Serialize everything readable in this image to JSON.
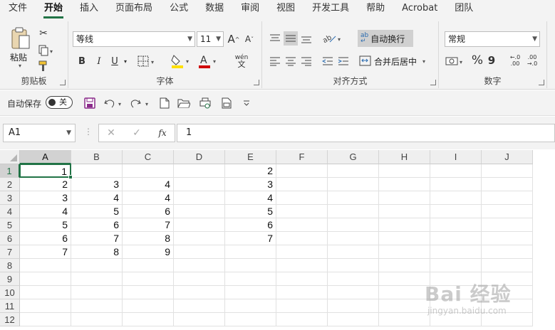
{
  "menu": {
    "tabs": [
      "文件",
      "开始",
      "插入",
      "页面布局",
      "公式",
      "数据",
      "审阅",
      "视图",
      "开发工具",
      "帮助",
      "Acrobat",
      "团队"
    ]
  },
  "ribbon": {
    "clipboard": {
      "label": "剪贴板",
      "paste_label": "粘贴"
    },
    "font": {
      "label": "字体",
      "font_name": "等线",
      "font_size": "11",
      "bold": "B",
      "italic": "I",
      "underline": "U",
      "grow": "A",
      "shrink": "A",
      "color_letter": "A",
      "phonetic": "wén"
    },
    "alignment": {
      "label": "对齐方式",
      "wrap_text": "自动换行",
      "merge_center": "合并后居中"
    },
    "number": {
      "label": "数字",
      "format": "常规",
      "percent": "%",
      "comma": "9"
    }
  },
  "qat": {
    "autosave_label": "自动保存",
    "autosave_state": "关"
  },
  "formula_bar": {
    "name_box": "A1",
    "formula": "1",
    "fx": "fx"
  },
  "sheet": {
    "columns": [
      "A",
      "B",
      "C",
      "D",
      "E",
      "F",
      "G",
      "H",
      "I",
      "J"
    ],
    "rows": [
      "1",
      "2",
      "3",
      "4",
      "5",
      "6",
      "7",
      "8",
      "9",
      "10",
      "11",
      "12"
    ],
    "cells": [
      [
        "1",
        "",
        "",
        "",
        "2",
        "",
        "",
        "",
        "",
        ""
      ],
      [
        "2",
        "3",
        "4",
        "",
        "3",
        "",
        "",
        "",
        "",
        ""
      ],
      [
        "3",
        "4",
        "4",
        "",
        "4",
        "",
        "",
        "",
        "",
        ""
      ],
      [
        "4",
        "5",
        "6",
        "",
        "5",
        "",
        "",
        "",
        "",
        ""
      ],
      [
        "5",
        "6",
        "7",
        "",
        "6",
        "",
        "",
        "",
        "",
        ""
      ],
      [
        "6",
        "7",
        "8",
        "",
        "7",
        "",
        "",
        "",
        "",
        ""
      ],
      [
        "7",
        "8",
        "9",
        "",
        "",
        "",
        "",
        "",
        "",
        ""
      ],
      [
        "",
        "",
        "",
        "",
        "",
        "",
        "",
        "",
        "",
        ""
      ],
      [
        "",
        "",
        "",
        "",
        "",
        "",
        "",
        "",
        "",
        ""
      ],
      [
        "",
        "",
        "",
        "",
        "",
        "",
        "",
        "",
        "",
        ""
      ],
      [
        "",
        "",
        "",
        "",
        "",
        "",
        "",
        "",
        "",
        ""
      ],
      [
        "",
        "",
        "",
        "",
        "",
        "",
        "",
        "",
        "",
        ""
      ]
    ],
    "active_cell": "A1"
  },
  "watermark": {
    "main": "Bai 经验",
    "sub": "jingyan.baidu.com"
  },
  "colors": {
    "accent": "#217346",
    "highlight": "#ffe000",
    "font_color": "#d00000",
    "save_icon": "#8a2a8a"
  }
}
